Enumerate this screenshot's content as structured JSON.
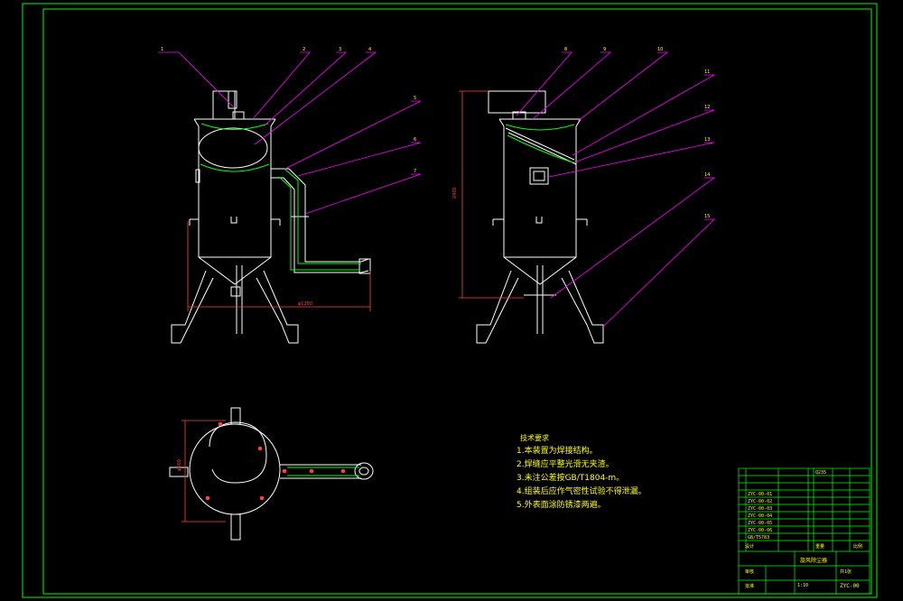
{
  "balloons": {
    "b1": "1",
    "b2": "2",
    "b3": "3",
    "b4": "4",
    "b5": "5",
    "b6": "6",
    "b7": "7",
    "b8": "8",
    "b9": "9",
    "b10": "10",
    "b11": "11",
    "b12": "12",
    "b13": "13",
    "b14": "14",
    "b15": "15"
  },
  "dimensions": {
    "front_width": "φ1250",
    "side_height": "2400",
    "top_width": "φ600"
  },
  "notes": {
    "title": "技术要求",
    "lines": [
      "1.本装置为焊接结构。",
      "2.焊缝应平整光滑无夹渣。",
      "3.未注公差按GB/T1804-m。",
      "4.组装后应作气密性试验不得泄漏。",
      "5.外表面涂防锈漆两遍。"
    ]
  },
  "title_block": {
    "drawing_name": "旋风除尘器",
    "drawing_no": "ZYC-00",
    "material": "Q235",
    "scale": "1:10",
    "sheet": "共1张",
    "row_codes": [
      "ZYC-00-01",
      "ZYC-00-02",
      "ZYC-00-03",
      "ZYC-00-04",
      "ZYC-00-05",
      "ZYC-00-06"
    ],
    "std_code": "GB/T5783",
    "labels": {
      "designer": "设计",
      "checker": "审核",
      "approver": "批准",
      "weight": "重量",
      "ratio": "比例"
    }
  },
  "colors": {
    "background": "#000000",
    "border": "#00ff00",
    "outline": "#ffffff",
    "leader": "#ff00ff",
    "weld": "#00ff00",
    "dimension": "#ff4040",
    "text": "#ffff00"
  }
}
